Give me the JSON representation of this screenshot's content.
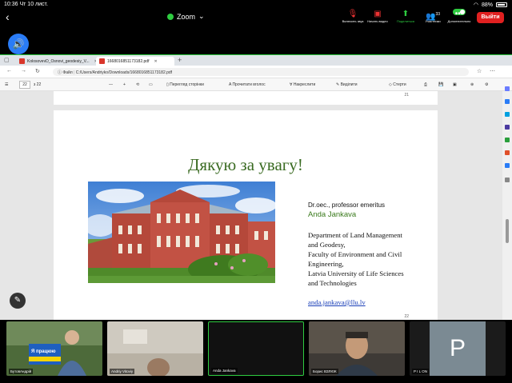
{
  "status_bar": {
    "time": "10:36",
    "date": "Чт 10 лист.",
    "battery": "88%"
  },
  "zoom": {
    "title": "Zoom",
    "toolbar": [
      {
        "label": "Включить звук",
        "icon": "mic-muted-icon"
      },
      {
        "label": "Начать видео",
        "icon": "video-off-icon"
      },
      {
        "label": "Поделиться",
        "icon": "share-icon"
      },
      {
        "label": "Участники",
        "icon": "participants-icon",
        "count": "33"
      },
      {
        "label": "Дополнительно",
        "icon": "more-icon"
      }
    ],
    "leave_label": "Выйти"
  },
  "browser": {
    "tabs": [
      {
        "label": "KolosovevD_Osnovi_geodesiy_V..."
      },
      {
        "label": "1668016851173182.pdf"
      }
    ],
    "new_tab": "+",
    "address_prefix": "Файл",
    "address": "C:/Users/Andriyko/Downloads/1668016851173182.pdf",
    "pdf_toolbar": {
      "page_current": "22",
      "page_total": "з 22",
      "view": "Перегляд сторінки",
      "read_aloud": "Прочитати вголос",
      "draw": "Накреслити",
      "highlight": "Виділити",
      "erase": "Стерти"
    }
  },
  "slide": {
    "prev_page_number": "21",
    "title": "Дякую за увагу!",
    "author_title": "Dr.oec., professor emeritus",
    "author_name": "Anda Jankava",
    "dept_lines": [
      "Department of Land Management",
      "and Geodesy,",
      "Faculty of Environment and Civil",
      "Engineering,",
      "Latvia University of Life Sciences",
      "and Technologies"
    ],
    "email": "anda.jankava@llu.lv",
    "page_number": "22"
  },
  "participants": [
    {
      "name": "БутовАндрій",
      "video": true,
      "banner": "Я працюю"
    },
    {
      "name": "Andriy Vitoviy",
      "video": true
    },
    {
      "name": "Anda Jankava",
      "video": false,
      "active": true
    },
    {
      "name": "Борис ВЗЛЮК",
      "video": true
    },
    {
      "name": "P I L ON",
      "video": false,
      "initial": "P"
    }
  ],
  "colors": {
    "accent_green": "#2ecc40",
    "leave_red": "#e02020",
    "title_green": "#3a6b22",
    "link_blue": "#1a3fb8"
  }
}
